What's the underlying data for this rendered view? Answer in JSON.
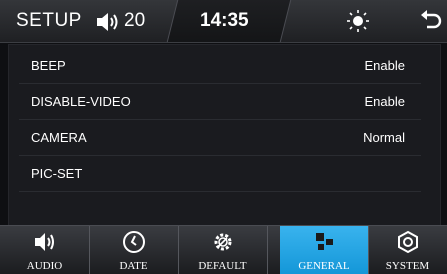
{
  "header": {
    "title": "SETUP",
    "volume": "20",
    "time": "14:35",
    "icons": [
      "speaker-icon",
      "brightness-icon",
      "back-icon"
    ]
  },
  "settings": [
    {
      "label": "BEEP",
      "value": "Enable"
    },
    {
      "label": "DISABLE-VIDEO",
      "value": "Enable"
    },
    {
      "label": "CAMERA",
      "value": "Normal"
    },
    {
      "label": "PIC-SET",
      "value": ""
    }
  ],
  "tabs": [
    {
      "label": "AUDIO",
      "icon": "speaker-icon"
    },
    {
      "label": "DATE",
      "icon": "clock-icon"
    },
    {
      "label": "DEFAULT",
      "icon": "gear-icon"
    },
    {
      "label": "GENERAL",
      "icon": "general-icon",
      "active": true
    },
    {
      "label": "SYSTEM",
      "icon": "system-icon"
    }
  ],
  "colors": {
    "accent": "#22a6e6",
    "background": "#0e0f12",
    "text": "#ffffff"
  }
}
